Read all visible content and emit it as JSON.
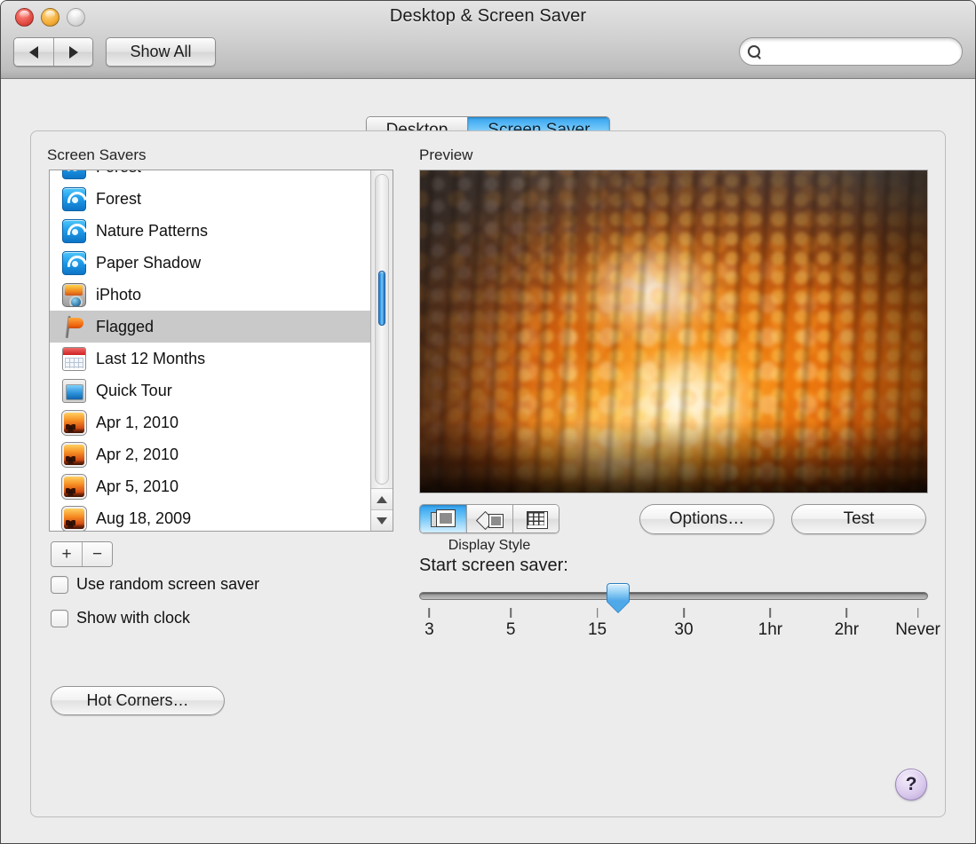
{
  "window": {
    "title": "Desktop & Screen Saver",
    "traffic_lights": [
      "close",
      "minimize",
      "zoom"
    ]
  },
  "toolbar": {
    "back_icon": "triangle-left-icon",
    "forward_icon": "triangle-right-icon",
    "show_all_label": "Show All",
    "search": {
      "value": "",
      "placeholder": "",
      "icon": "search-icon"
    }
  },
  "tabs": [
    {
      "label": "Desktop",
      "selected": false
    },
    {
      "label": "Screen Saver",
      "selected": true
    }
  ],
  "left_pane": {
    "label": "Screen Savers",
    "items": [
      {
        "label": "Forest",
        "icon": "swirl",
        "selected": false
      },
      {
        "label": "Nature Patterns",
        "icon": "swirl",
        "selected": false
      },
      {
        "label": "Paper Shadow",
        "icon": "swirl",
        "selected": false
      },
      {
        "label": "iPhoto",
        "icon": "iphoto",
        "selected": false
      },
      {
        "label": "Flagged",
        "icon": "flag",
        "selected": true
      },
      {
        "label": "Last 12 Months",
        "icon": "cal",
        "selected": false
      },
      {
        "label": "Quick Tour",
        "icon": "quicktour",
        "selected": false
      },
      {
        "label": "Apr 1, 2010",
        "icon": "sunset",
        "selected": false
      },
      {
        "label": "Apr 2, 2010",
        "icon": "sunset",
        "selected": false
      },
      {
        "label": "Apr 5, 2010",
        "icon": "sunset",
        "selected": false
      },
      {
        "label": "Aug 18, 2009",
        "icon": "sunset",
        "selected": false
      }
    ],
    "add_label": "+",
    "remove_label": "−",
    "checkboxes": [
      {
        "label": "Use random screen saver",
        "checked": false
      },
      {
        "label": "Show with clock",
        "checked": false
      }
    ]
  },
  "right_pane": {
    "preview_label": "Preview",
    "preview_description": "Blurred bokeh sunset seen through rain-covered glass",
    "display_style": {
      "label": "Display Style",
      "options": [
        {
          "icon": "slideshow-stack-icon",
          "selected": true
        },
        {
          "icon": "collage-icon",
          "selected": false
        },
        {
          "icon": "mosaic-grid-icon",
          "selected": false
        }
      ]
    },
    "options_button": "Options…",
    "test_button": "Test",
    "slider": {
      "label": "Start screen saver:",
      "value_percent": 39,
      "ticks": [
        "3",
        "5",
        "15",
        "30",
        "1hr",
        "2hr",
        "Never"
      ],
      "tick_percents": [
        2,
        18,
        35,
        52,
        69,
        84,
        98
      ]
    }
  },
  "footer": {
    "hot_corners_label": "Hot Corners…",
    "help_label": "?",
    "help_icon": "help-icon"
  },
  "colors": {
    "accent_blue": "#35a3ef",
    "selection_gray": "#c9c9c9",
    "window_bg": "#ececec",
    "help_purple": "#b9a3d6"
  }
}
